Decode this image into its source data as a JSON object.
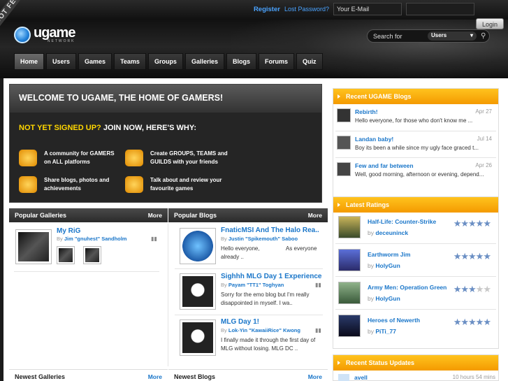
{
  "header": {
    "register": "Register",
    "lost_password": "Lost Password?",
    "email_placeholder": "Your E-Mail",
    "login": "Login",
    "ribbon": "GOT FEEDBACK?",
    "logo": "ugame",
    "logo_sub": "NETWORK",
    "search_label": "Search for",
    "search_option": "Users"
  },
  "nav": [
    "Home",
    "Users",
    "Games",
    "Teams",
    "Groups",
    "Galleries",
    "Blogs",
    "Forums",
    "Quiz"
  ],
  "welcome": {
    "title": "WELCOME TO UGAME, THE HOME OF GAMERS!",
    "sub_yellow": "NOT YET SIGNED UP?",
    "sub_white": "JOIN NOW, HERE'S WHY:",
    "features": [
      {
        "line1": "A community for GAMERS",
        "line2": "on ALL platforms",
        "icon": "radiation-icon"
      },
      {
        "line1": "Create GROUPS, TEAMS and",
        "line2": "GUILDS with your friends",
        "icon": "group-icon"
      },
      {
        "line1": "Share blogs, photos and",
        "line2": "achievements",
        "icon": "photos-icon"
      },
      {
        "line1": "Talk about and review your",
        "line2": "favourite games",
        "icon": "gamepad-icon"
      }
    ]
  },
  "popular_galleries": {
    "heading": "Popular Galleries",
    "more": "More",
    "item": {
      "title": "My RiG",
      "by": "By",
      "author": "Jim \"gnuhest\" Sandholm",
      "views": "▮▮"
    }
  },
  "popular_blogs": {
    "heading": "Popular Blogs",
    "more": "More",
    "items": [
      {
        "title": "FnaticMSI And The Halo Rea..",
        "by": "By",
        "author": "Justin \"Spikemouth\" Saboo",
        "text1": "Hello everyone,                 As everyone",
        "text2": "already .."
      },
      {
        "title": "Sighhh MLG Day 1 Experience",
        "by": "By",
        "author": "Payam \"TT1\" Toghyan",
        "text1": "Sorry for the emo blog but I'm really",
        "text2": "disappointed in myself. I wa.."
      },
      {
        "title": "MLG Day 1!",
        "by": "By",
        "author": "Lok-Yin \"KawaiiRice\" Kwong",
        "text1": "I finally made it through the first day of",
        "text2": "MLG without losing. MLG DC .."
      }
    ]
  },
  "newest_galleries": {
    "heading": "Newest Galleries",
    "more": "More"
  },
  "newest_blogs": {
    "heading": "Newest Blogs",
    "more": "More"
  },
  "recent_blogs": {
    "heading": "Recent UGAME Blogs",
    "items": [
      {
        "title": "Rebirth!",
        "date": "Apr 27",
        "text": "Hello everyone, for those who don't know me ..."
      },
      {
        "title": "Landan baby!",
        "date": "Jul 14",
        "text": "Boy its been a while since my ugly face graced t..."
      },
      {
        "title": "Few and far between",
        "date": "Apr 26",
        "text": "Well, good morning, afternoon or evening, depend..."
      }
    ]
  },
  "latest_ratings": {
    "heading": "Latest Ratings",
    "items": [
      {
        "title": "Half-Life: Counter-Strike",
        "by": "by",
        "user": "deceuninck",
        "stars": 5
      },
      {
        "title": "Earthworm Jim",
        "by": "by",
        "user": "HolyGun",
        "stars": 5
      },
      {
        "title": "Army Men: Operation Green",
        "by": "by",
        "user": "HolyGun",
        "stars": 3
      },
      {
        "title": "Heroes of Newerth",
        "by": "by",
        "user": "PiTi_77",
        "stars": 5
      }
    ]
  },
  "status_updates": {
    "heading": "Recent Status Updates",
    "user": "avell",
    "time": "10 hours 54 mins"
  }
}
